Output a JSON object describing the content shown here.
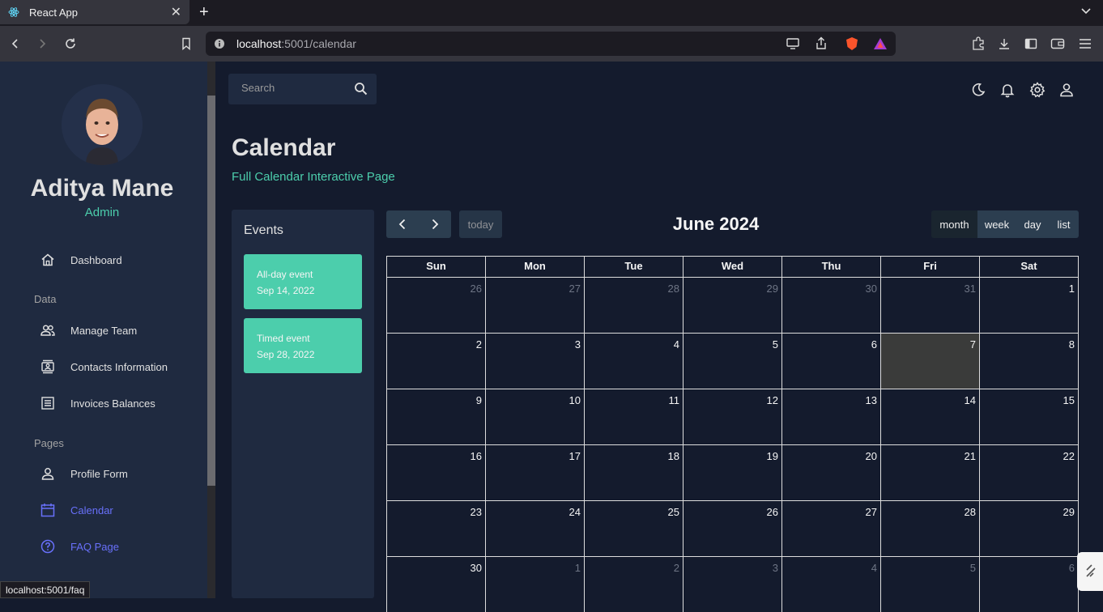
{
  "browser": {
    "tab_title": "React App",
    "url_host": "localhost",
    "url_path": ":5001/calendar",
    "status_url": "localhost:5001/faq"
  },
  "sidebar": {
    "user_name": "Aditya Mane",
    "user_role": "Admin",
    "items": [
      {
        "label": "Dashboard",
        "icon": "home-icon"
      },
      {
        "label": "Manage Team",
        "icon": "people-icon"
      },
      {
        "label": "Contacts Information",
        "icon": "contacts-icon"
      },
      {
        "label": "Invoices Balances",
        "icon": "receipt-icon"
      },
      {
        "label": "Profile Form",
        "icon": "person-icon"
      },
      {
        "label": "Calendar",
        "icon": "calendar-icon"
      },
      {
        "label": "FAQ Page",
        "icon": "help-icon"
      }
    ],
    "sections": {
      "data": "Data",
      "pages": "Pages"
    },
    "active_color": "#6870fa"
  },
  "topbar": {
    "search_placeholder": "Search"
  },
  "header": {
    "title": "Calendar",
    "subtitle": "Full Calendar Interactive Page"
  },
  "events": {
    "title": "Events",
    "list": [
      {
        "title": "All-day event",
        "date": "Sep 14, 2022"
      },
      {
        "title": "Timed event",
        "date": "Sep 28, 2022"
      }
    ]
  },
  "calendar": {
    "title": "June 2024",
    "today_label": "today",
    "views": [
      "month",
      "week",
      "day",
      "list"
    ],
    "active_view": "month",
    "weekdays": [
      "Sun",
      "Mon",
      "Tue",
      "Wed",
      "Thu",
      "Fri",
      "Sat"
    ],
    "weeks": [
      [
        "26",
        "27",
        "28",
        "29",
        "30",
        "31",
        "1"
      ],
      [
        "2",
        "3",
        "4",
        "5",
        "6",
        "7",
        "8"
      ],
      [
        "9",
        "10",
        "11",
        "12",
        "13",
        "14",
        "15"
      ],
      [
        "16",
        "17",
        "18",
        "19",
        "20",
        "21",
        "22"
      ],
      [
        "23",
        "24",
        "25",
        "26",
        "27",
        "28",
        "29"
      ],
      [
        "30",
        "1",
        "2",
        "3",
        "4",
        "5",
        "6"
      ]
    ],
    "today_date": "7"
  },
  "colors": {
    "accent_green": "#4cceac",
    "background": "#141b2d",
    "panel": "#1f2a40"
  }
}
